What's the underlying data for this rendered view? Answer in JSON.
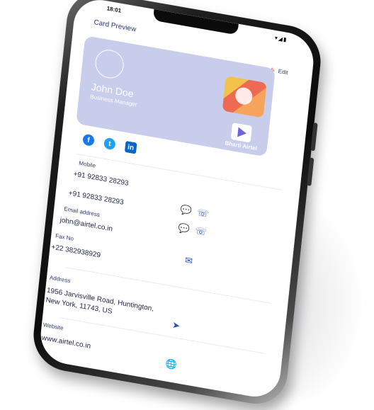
{
  "status": {
    "time": "18:01",
    "icons": "▾◢▮"
  },
  "header": {
    "title": "Card Preview"
  },
  "actions": {
    "edit_label": "Edit"
  },
  "card": {
    "name": "John Doe",
    "role": "Business Manager",
    "brand": "Bharti Airtel"
  },
  "socials": [
    {
      "name": "facebook-icon",
      "glyph": "f"
    },
    {
      "name": "twitter-icon",
      "glyph": "t"
    },
    {
      "name": "linkedin-icon",
      "glyph": "in"
    },
    {
      "name": "apple-icon",
      "glyph": ""
    }
  ],
  "contact": {
    "mobile_label": "Mobile",
    "mobiles": [
      "+91 92833 28293",
      "+91 92833 28293"
    ],
    "email_label": "Email address",
    "email": "john@airtel.co.in",
    "fax_label": "Fax No",
    "fax": "+22 382938929",
    "address_label": "Address",
    "address_line1": "1956 Jarvisville Road, Huntington,",
    "address_line2": "New York, 11743, US",
    "website_label": "Website",
    "website": "www.airtel.co.in"
  },
  "colors": {
    "card_bg": "#c8cdec",
    "accent": "#2d4fb8",
    "edit_icon": "#e0524b"
  }
}
